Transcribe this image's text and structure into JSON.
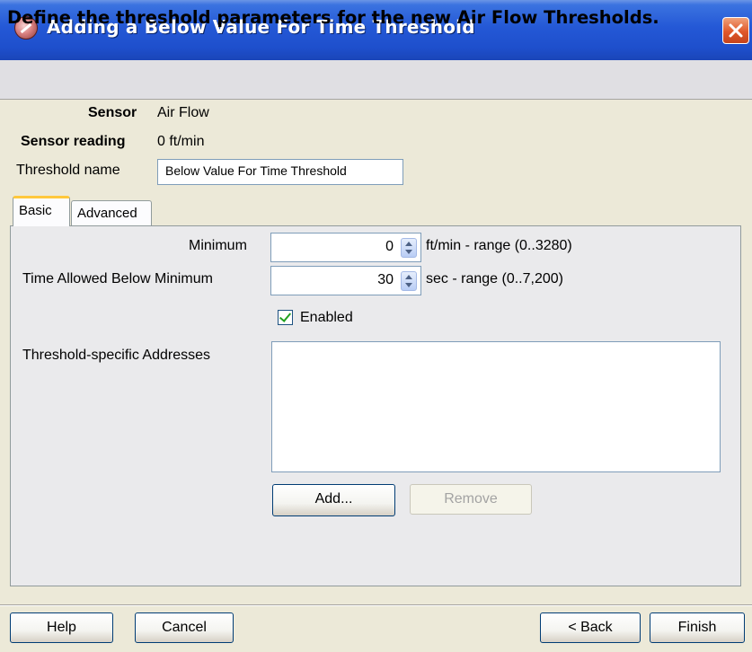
{
  "window": {
    "title": "Adding a Below Value For Time Threshold"
  },
  "header": {
    "text": "Define the threshold parameters for the new Air Flow Thresholds."
  },
  "info": {
    "sensor_label": "Sensor",
    "sensor_value": "Air Flow",
    "reading_label": "Sensor reading",
    "reading_value": "0 ft/min",
    "name_label": "Threshold name",
    "name_value": "Below Value For Time Threshold"
  },
  "tabs": [
    {
      "label": "Basic",
      "active": true
    },
    {
      "label": "Advanced",
      "active": false
    }
  ],
  "basic": {
    "minimum_label": "Minimum",
    "minimum_value": "0",
    "minimum_unit": "ft/min - range (0..3280)",
    "time_label": "Time Allowed Below Minimum",
    "time_value": "30",
    "time_unit": "sec - range (0..7,200)",
    "enabled_label": "Enabled",
    "enabled_checked": true,
    "addresses_label": "Threshold-specific Addresses",
    "addresses": [],
    "add_label": "Add...",
    "remove_label": "Remove"
  },
  "footer": {
    "help": "Help",
    "cancel": "Cancel",
    "back": "< Back",
    "finish": "Finish"
  },
  "colors": {
    "titlebar": "#2458d6",
    "dialog_bg": "#ece9d8",
    "panel_bg": "#eaeaec",
    "check_green": "#21a121",
    "close_red": "#e0582a"
  },
  "icons": [
    "app-icon",
    "close-icon",
    "spin-icon",
    "check-icon"
  ]
}
